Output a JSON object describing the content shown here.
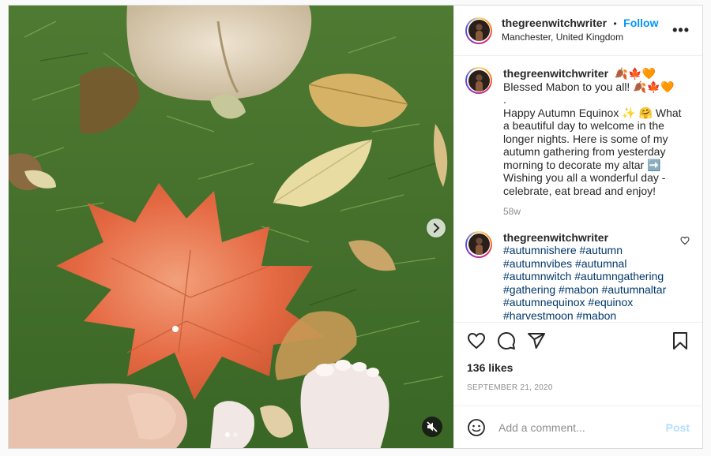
{
  "header": {
    "username": "thegreenwitchwriter",
    "separator": "•",
    "follow_label": "Follow",
    "location": "Manchester, United Kingdom",
    "more_label": "•••"
  },
  "caption": {
    "username": "thegreenwitchwriter",
    "text": "🍂🍁🧡 Blessed Mabon to you all! 🍂🍁🧡\n.\nHappy Autumn Equinox ✨ 🤗 What a beautiful day to welcome in the longer nights. Here is some of my autumn gathering from yesterday morning to decorate my altar ➡️ Wishing you all a wonderful day - celebrate, eat bread and enjoy!",
    "time": "58w"
  },
  "comment": {
    "username": "thegreenwitchwriter",
    "text": "#autumnishere #autumn #autumnvibes #autumnal #autumnwitch #autumngathering #gathering #mabon #autumnaltar #autumnequinox #equinox #harvestmoon #mabon"
  },
  "likes": "136 likes",
  "date": "SEPTEMBER 21, 2020",
  "add_comment": {
    "placeholder": "Add a comment...",
    "post_label": "Post"
  },
  "icons": {
    "like": "heart-icon",
    "comment": "comment-bubble-icon",
    "share": "paper-plane-icon",
    "save": "bookmark-icon",
    "emoji": "smiley-icon",
    "next": "chevron-right-icon",
    "mute": "speaker-muted-icon"
  },
  "colors": {
    "accent": "#0095f6",
    "post_disabled": "#b2dffc",
    "hashtag": "#00376b",
    "muted": "#8e8e8e"
  }
}
